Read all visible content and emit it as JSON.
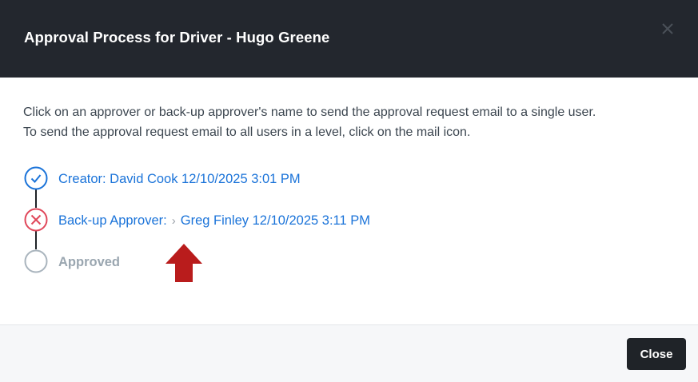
{
  "dialog": {
    "title": "Approval Process for Driver - Hugo Greene",
    "close_icon": "close-icon"
  },
  "body": {
    "intro_line1": "Click on an approver or back-up approver's name to send the approval request email to a single user.",
    "intro_line2": "To send the approval request email to all users in a level, click on the mail icon."
  },
  "steps": [
    {
      "status": "complete",
      "icon": "check-circle-icon",
      "label": "Creator: David Cook 12/10/2025 3:01 PM"
    },
    {
      "status": "rejected",
      "icon": "x-circle-icon",
      "role_label": "Back-up Approver:",
      "separator_icon": "chevron-right-icon",
      "name_label": "Greg Finley 12/10/2025 3:11 PM"
    },
    {
      "status": "pending",
      "icon": "empty-circle-icon",
      "label": "Approved"
    }
  ],
  "annotation": {
    "icon": "red-up-arrow-icon"
  },
  "footer": {
    "close_label": "Close"
  },
  "colors": {
    "header_bg": "#23272e",
    "link": "#1a73d9",
    "complete": "#1a73d9",
    "rejected": "#e0475a",
    "pending": "#a9b4bd",
    "arrow": "#b91c1c",
    "button_bg": "#1f2328",
    "footer_bg": "#f6f7f9"
  }
}
